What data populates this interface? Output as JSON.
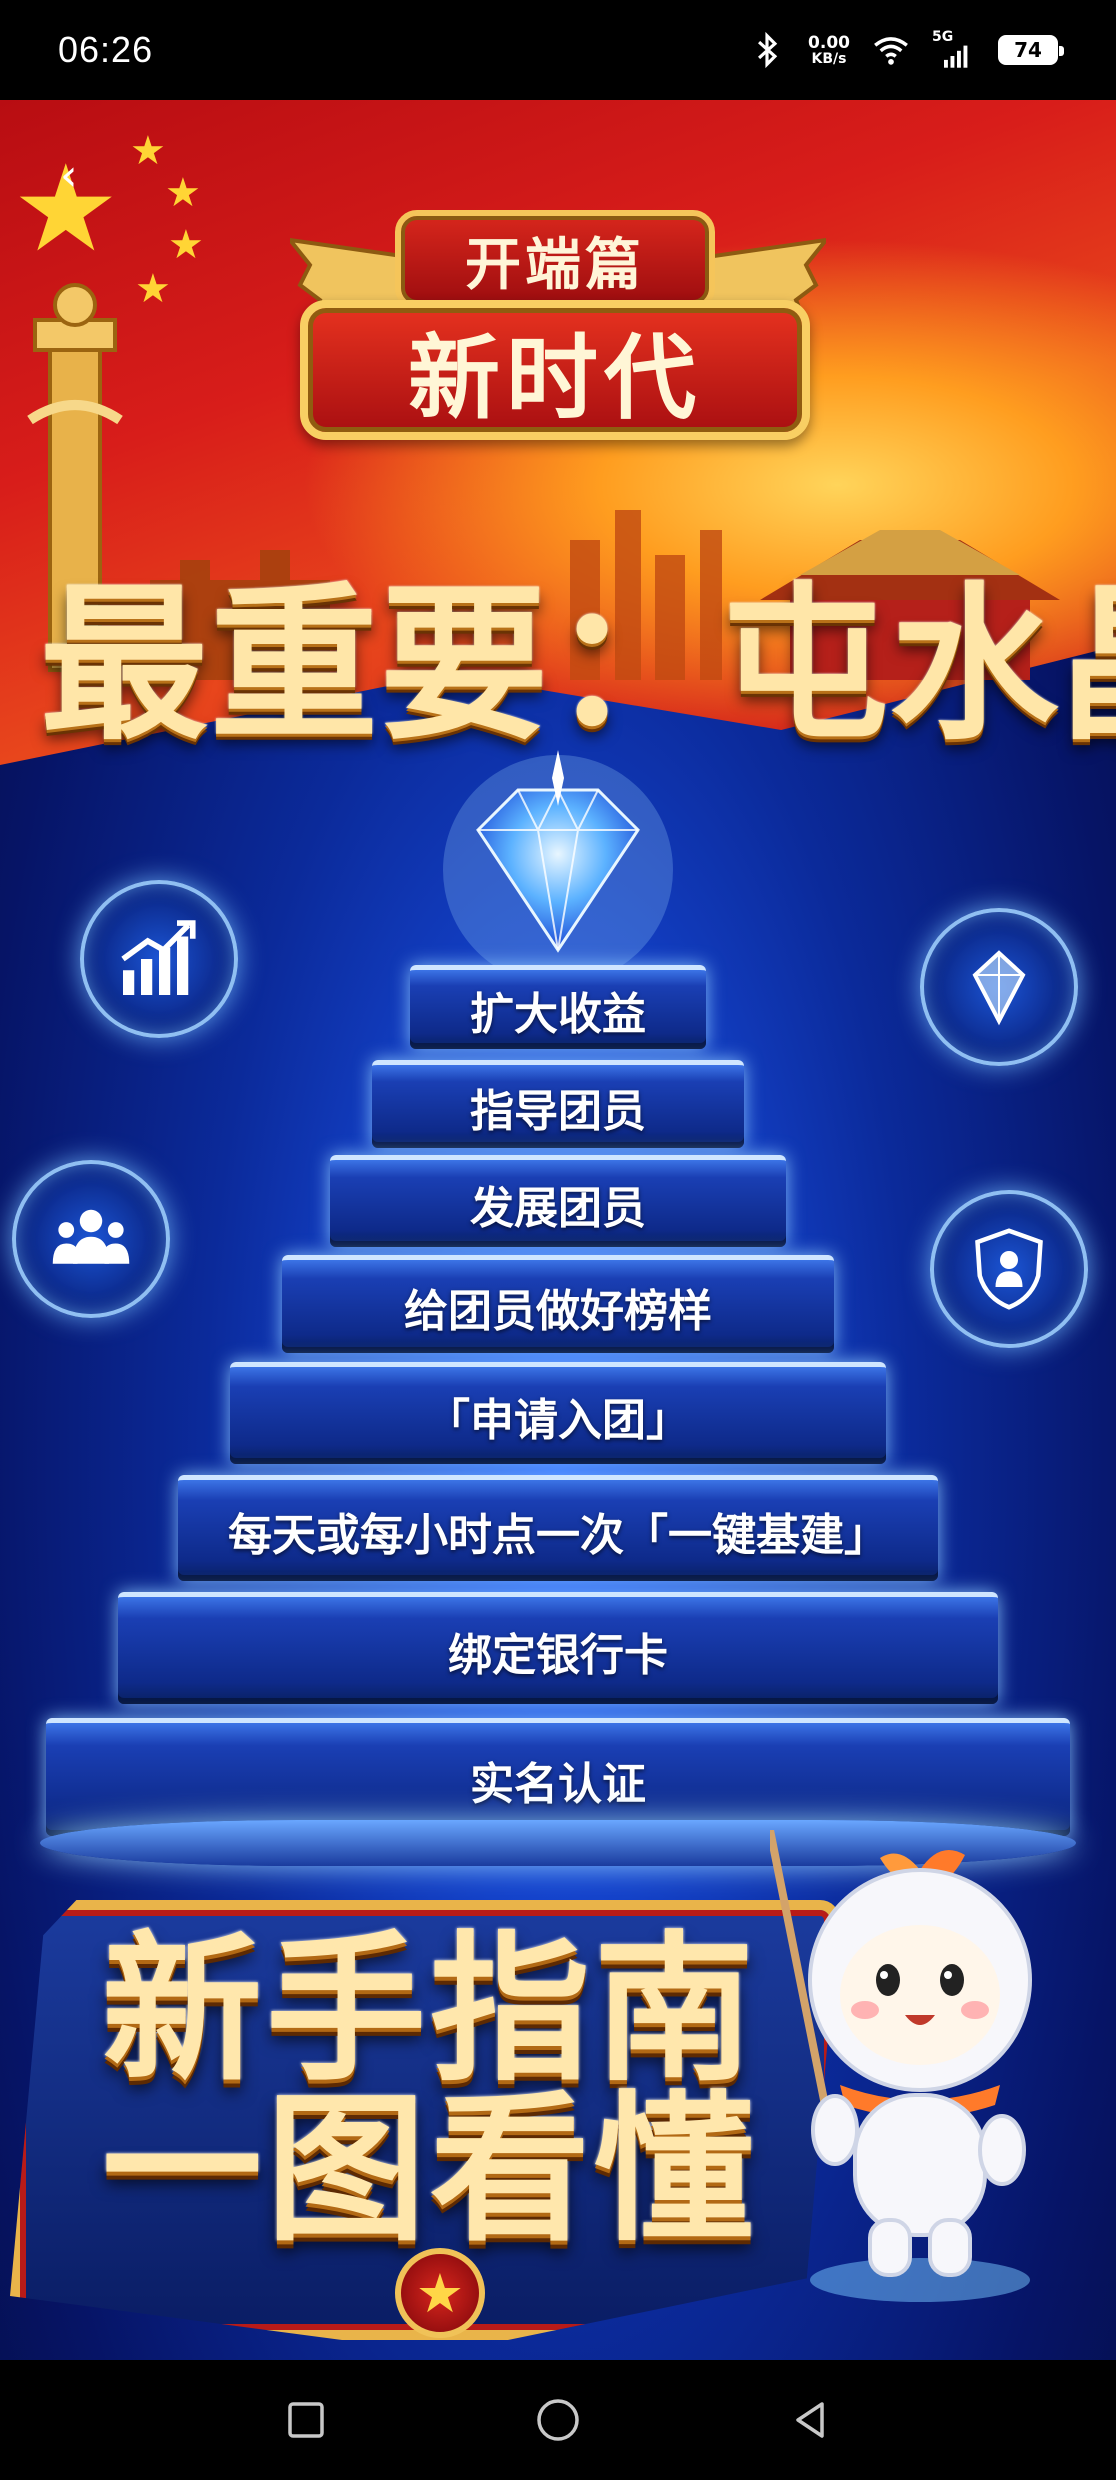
{
  "status_bar": {
    "time": "06:26",
    "net_speed_value": "0.00",
    "net_speed_unit": "KB/s",
    "network_type": "5G",
    "battery_level": "74"
  },
  "poster": {
    "back_glyph": "‹",
    "chapter_label": "开端篇",
    "era_label": "新时代",
    "headline": "最重要：屯水晶",
    "steps": [
      "扩大收益",
      "指导团员",
      "发展团员",
      "给团员做好榜样",
      "「申请入团」",
      "每天或每小时点一次「一键基建」",
      "绑定银行卡",
      "实名认证"
    ],
    "banner_line1": "新手指南",
    "banner_line2": "一图看懂",
    "banner_star": "★",
    "colors": {
      "red": "#c9171a",
      "gold": "#f5c55a",
      "blue": "#0e2a8a",
      "glow": "#cfe6ff"
    },
    "icons": [
      "growth-chart-icon",
      "crystal-icon",
      "team-icon",
      "shield-team-icon",
      "diamond-icon",
      "mascot-icon"
    ]
  },
  "nav_bar": {
    "buttons": [
      "recents-button",
      "home-button",
      "back-button"
    ]
  }
}
